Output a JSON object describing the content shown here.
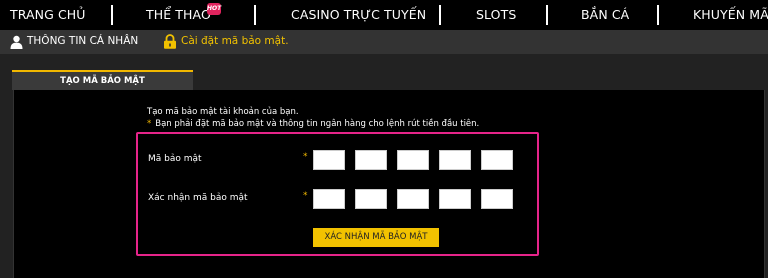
{
  "nav": {
    "items": [
      "TRANG CHỦ",
      "THỂ THAO",
      "CASINO TRỰC TUYẾN",
      "SLOTS",
      "BẮN CÁ",
      "KHUYẾN MÃI"
    ],
    "hot_badge": "HOT"
  },
  "subnav": {
    "profile_label": "THÔNG TIN CÁ NHÂN",
    "security_label": "Cài đặt mã bảo mật."
  },
  "tab": {
    "label": "TẠO MÃ BẢO MẬT"
  },
  "form": {
    "intro": "Tạo mã bảo mật tài khoản của bạn.",
    "note": "Bạn phải đặt mã bảo mật và thông tin ngân hàng cho lệnh rút tiền đầu tiên.",
    "note_star": "*",
    "pin_label": "Mã bảo mật",
    "confirm_label": "Xác nhận mã bảo mật",
    "required_mark": "*",
    "submit_label": "XÁC NHẬN MÃ BẢO MẬT"
  },
  "colors": {
    "accent": "#f2c200",
    "highlight_border": "#e6248a",
    "hot_badge": "#e0245e"
  }
}
